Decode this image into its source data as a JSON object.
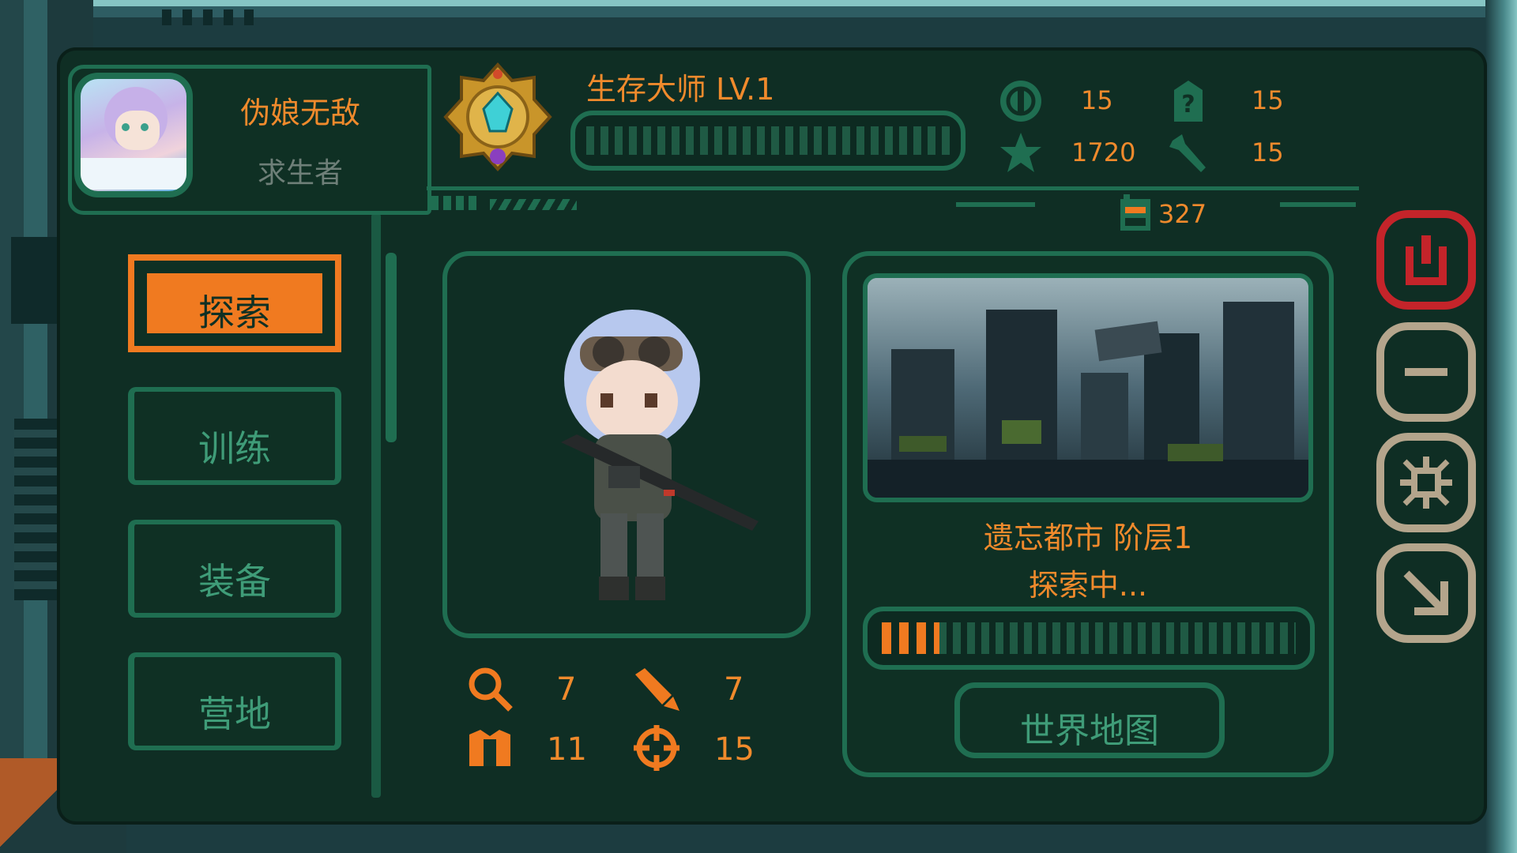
{
  "profile": {
    "name": "伪娘无敌",
    "title": "求生者"
  },
  "rank": {
    "title": "生存大师 LV.1",
    "xp_progress": 0.0
  },
  "stats": {
    "coins": "15",
    "unknown": "15",
    "stars": "1720",
    "tools": "15",
    "battery": "327"
  },
  "nav": {
    "explore": "探索",
    "train": "训练",
    "equip": "装备",
    "camp": "营地"
  },
  "character": {
    "search": "7",
    "ammo": "7",
    "armor": "11",
    "aim": "15"
  },
  "map": {
    "name": "遗忘都市 阶层1",
    "status": "探索中...",
    "progress": 0.14,
    "world_map_button": "世界地图"
  },
  "colors": {
    "accent": "#f07a20",
    "frame_green": "#1f6e51",
    "text_green": "#3f9c78",
    "power_red": "#c4242a",
    "side_btn": "#b4a58c"
  }
}
